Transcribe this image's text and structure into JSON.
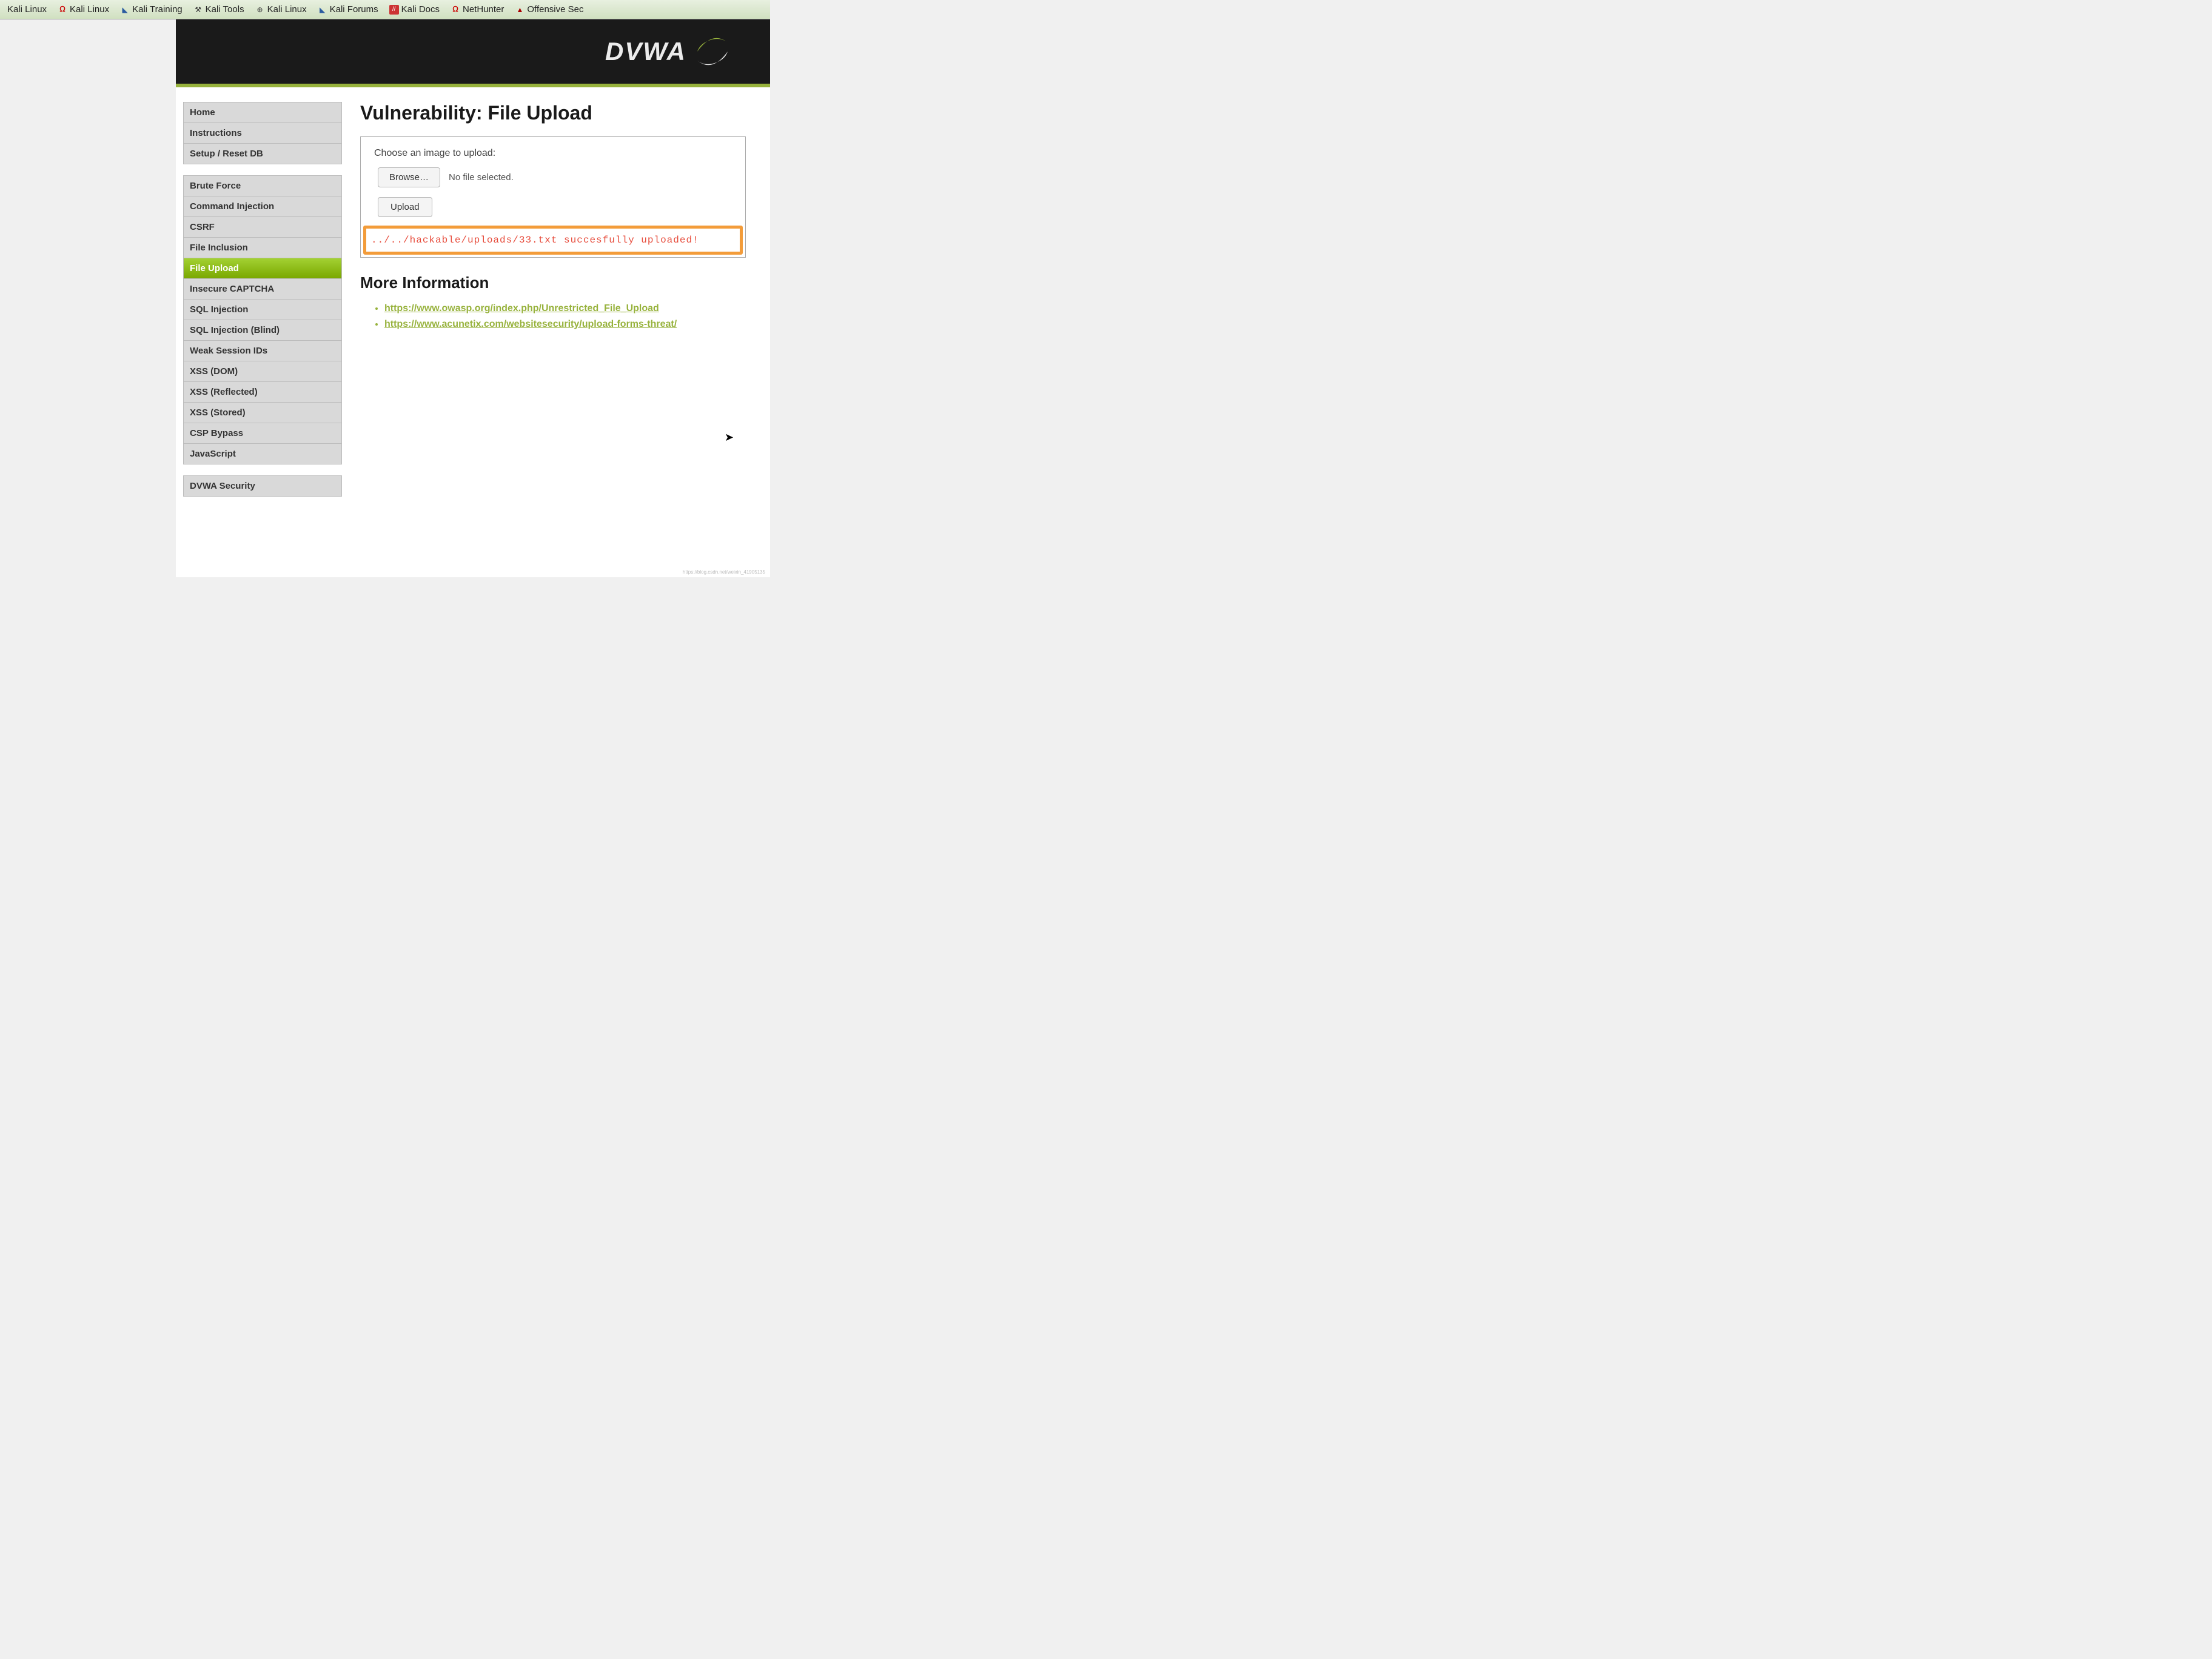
{
  "bookmarks": [
    {
      "label": "Kali Linux",
      "icon": "kali"
    },
    {
      "label": "Kali Linux",
      "icon": "kali-dragon"
    },
    {
      "label": "Kali Training",
      "icon": "kali-blue"
    },
    {
      "label": "Kali Tools",
      "icon": "tool"
    },
    {
      "label": "Kali Linux",
      "icon": "globe"
    },
    {
      "label": "Kali Forums",
      "icon": "kali-blue"
    },
    {
      "label": "Kali Docs",
      "icon": "docs"
    },
    {
      "label": "NetHunter",
      "icon": "kali-dragon"
    },
    {
      "label": "Offensive Sec",
      "icon": "offensive"
    }
  ],
  "logo": "DVWA",
  "sidebar": {
    "group1": [
      {
        "label": "Home"
      },
      {
        "label": "Instructions"
      },
      {
        "label": "Setup / Reset DB"
      }
    ],
    "group2": [
      {
        "label": "Brute Force"
      },
      {
        "label": "Command Injection"
      },
      {
        "label": "CSRF"
      },
      {
        "label": "File Inclusion"
      },
      {
        "label": "File Upload",
        "active": true
      },
      {
        "label": "Insecure CAPTCHA"
      },
      {
        "label": "SQL Injection"
      },
      {
        "label": "SQL Injection (Blind)"
      },
      {
        "label": "Weak Session IDs"
      },
      {
        "label": "XSS (DOM)"
      },
      {
        "label": "XSS (Reflected)"
      },
      {
        "label": "XSS (Stored)"
      },
      {
        "label": "CSP Bypass"
      },
      {
        "label": "JavaScript"
      }
    ],
    "group3": [
      {
        "label": "DVWA Security"
      }
    ]
  },
  "main": {
    "title": "Vulnerability: File Upload",
    "form_label": "Choose an image to upload:",
    "browse": "Browse…",
    "no_file": "No file selected.",
    "upload": "Upload",
    "result": "../../hackable/uploads/33.txt succesfully uploaded!",
    "more_info": "More Information",
    "links": [
      "https://www.owasp.org/index.php/Unrestricted_File_Upload",
      "https://www.acunetix.com/websitesecurity/upload-forms-threat/"
    ]
  },
  "watermark": "https://blog.csdn.net/weixin_41905135"
}
